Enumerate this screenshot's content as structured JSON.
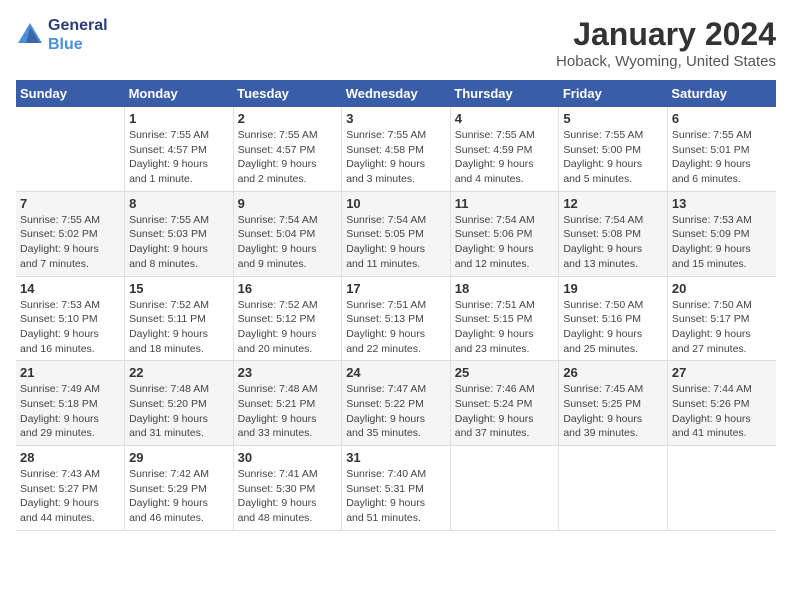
{
  "logo": {
    "line1": "General",
    "line2": "Blue"
  },
  "title": "January 2024",
  "location": "Hoback, Wyoming, United States",
  "weekdays": [
    "Sunday",
    "Monday",
    "Tuesday",
    "Wednesday",
    "Thursday",
    "Friday",
    "Saturday"
  ],
  "weeks": [
    [
      {
        "day": "",
        "info": ""
      },
      {
        "day": "1",
        "info": "Sunrise: 7:55 AM\nSunset: 4:57 PM\nDaylight: 9 hours\nand 1 minute."
      },
      {
        "day": "2",
        "info": "Sunrise: 7:55 AM\nSunset: 4:57 PM\nDaylight: 9 hours\nand 2 minutes."
      },
      {
        "day": "3",
        "info": "Sunrise: 7:55 AM\nSunset: 4:58 PM\nDaylight: 9 hours\nand 3 minutes."
      },
      {
        "day": "4",
        "info": "Sunrise: 7:55 AM\nSunset: 4:59 PM\nDaylight: 9 hours\nand 4 minutes."
      },
      {
        "day": "5",
        "info": "Sunrise: 7:55 AM\nSunset: 5:00 PM\nDaylight: 9 hours\nand 5 minutes."
      },
      {
        "day": "6",
        "info": "Sunrise: 7:55 AM\nSunset: 5:01 PM\nDaylight: 9 hours\nand 6 minutes."
      }
    ],
    [
      {
        "day": "7",
        "info": "Sunrise: 7:55 AM\nSunset: 5:02 PM\nDaylight: 9 hours\nand 7 minutes."
      },
      {
        "day": "8",
        "info": "Sunrise: 7:55 AM\nSunset: 5:03 PM\nDaylight: 9 hours\nand 8 minutes."
      },
      {
        "day": "9",
        "info": "Sunrise: 7:54 AM\nSunset: 5:04 PM\nDaylight: 9 hours\nand 9 minutes."
      },
      {
        "day": "10",
        "info": "Sunrise: 7:54 AM\nSunset: 5:05 PM\nDaylight: 9 hours\nand 11 minutes."
      },
      {
        "day": "11",
        "info": "Sunrise: 7:54 AM\nSunset: 5:06 PM\nDaylight: 9 hours\nand 12 minutes."
      },
      {
        "day": "12",
        "info": "Sunrise: 7:54 AM\nSunset: 5:08 PM\nDaylight: 9 hours\nand 13 minutes."
      },
      {
        "day": "13",
        "info": "Sunrise: 7:53 AM\nSunset: 5:09 PM\nDaylight: 9 hours\nand 15 minutes."
      }
    ],
    [
      {
        "day": "14",
        "info": "Sunrise: 7:53 AM\nSunset: 5:10 PM\nDaylight: 9 hours\nand 16 minutes."
      },
      {
        "day": "15",
        "info": "Sunrise: 7:52 AM\nSunset: 5:11 PM\nDaylight: 9 hours\nand 18 minutes."
      },
      {
        "day": "16",
        "info": "Sunrise: 7:52 AM\nSunset: 5:12 PM\nDaylight: 9 hours\nand 20 minutes."
      },
      {
        "day": "17",
        "info": "Sunrise: 7:51 AM\nSunset: 5:13 PM\nDaylight: 9 hours\nand 22 minutes."
      },
      {
        "day": "18",
        "info": "Sunrise: 7:51 AM\nSunset: 5:15 PM\nDaylight: 9 hours\nand 23 minutes."
      },
      {
        "day": "19",
        "info": "Sunrise: 7:50 AM\nSunset: 5:16 PM\nDaylight: 9 hours\nand 25 minutes."
      },
      {
        "day": "20",
        "info": "Sunrise: 7:50 AM\nSunset: 5:17 PM\nDaylight: 9 hours\nand 27 minutes."
      }
    ],
    [
      {
        "day": "21",
        "info": "Sunrise: 7:49 AM\nSunset: 5:18 PM\nDaylight: 9 hours\nand 29 minutes."
      },
      {
        "day": "22",
        "info": "Sunrise: 7:48 AM\nSunset: 5:20 PM\nDaylight: 9 hours\nand 31 minutes."
      },
      {
        "day": "23",
        "info": "Sunrise: 7:48 AM\nSunset: 5:21 PM\nDaylight: 9 hours\nand 33 minutes."
      },
      {
        "day": "24",
        "info": "Sunrise: 7:47 AM\nSunset: 5:22 PM\nDaylight: 9 hours\nand 35 minutes."
      },
      {
        "day": "25",
        "info": "Sunrise: 7:46 AM\nSunset: 5:24 PM\nDaylight: 9 hours\nand 37 minutes."
      },
      {
        "day": "26",
        "info": "Sunrise: 7:45 AM\nSunset: 5:25 PM\nDaylight: 9 hours\nand 39 minutes."
      },
      {
        "day": "27",
        "info": "Sunrise: 7:44 AM\nSunset: 5:26 PM\nDaylight: 9 hours\nand 41 minutes."
      }
    ],
    [
      {
        "day": "28",
        "info": "Sunrise: 7:43 AM\nSunset: 5:27 PM\nDaylight: 9 hours\nand 44 minutes."
      },
      {
        "day": "29",
        "info": "Sunrise: 7:42 AM\nSunset: 5:29 PM\nDaylight: 9 hours\nand 46 minutes."
      },
      {
        "day": "30",
        "info": "Sunrise: 7:41 AM\nSunset: 5:30 PM\nDaylight: 9 hours\nand 48 minutes."
      },
      {
        "day": "31",
        "info": "Sunrise: 7:40 AM\nSunset: 5:31 PM\nDaylight: 9 hours\nand 51 minutes."
      },
      {
        "day": "",
        "info": ""
      },
      {
        "day": "",
        "info": ""
      },
      {
        "day": "",
        "info": ""
      }
    ]
  ]
}
